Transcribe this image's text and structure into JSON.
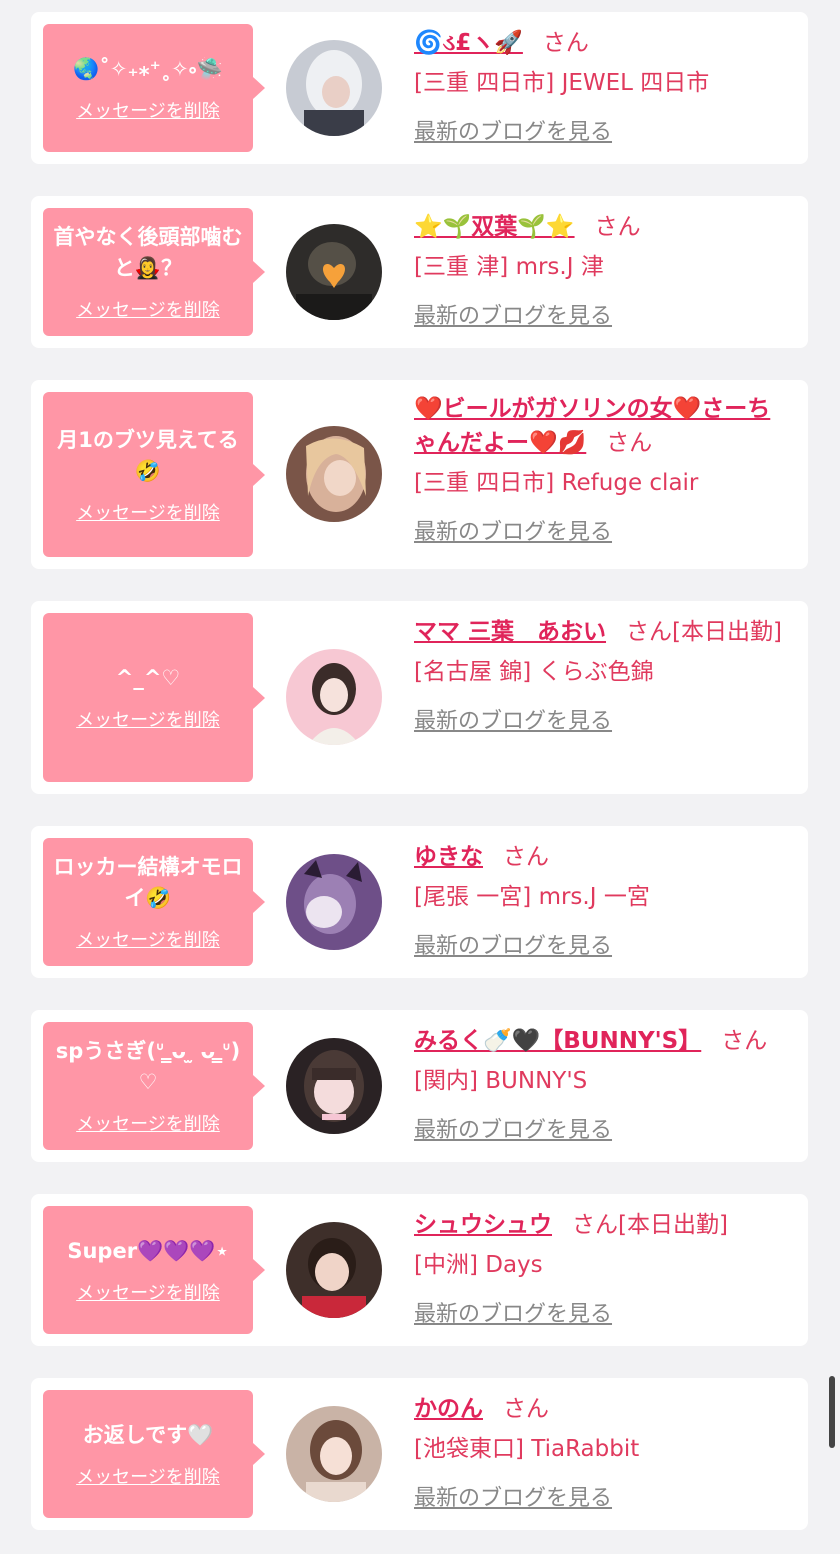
{
  "delete_label": "メッセージを削除",
  "san_label": "さん",
  "blog_label": "最新のブログを見る",
  "colors": {
    "background": "#f2f2f4",
    "bubble": "#ff96a6",
    "name": "#e0245a",
    "location": "#e03a5e",
    "blog_link": "#888888"
  },
  "entries": [
    {
      "message": "🌏˚✧₊⁎⁺˳✧༚🛸",
      "name": "🌀ડ£ヽ🚀",
      "suffix": "",
      "location": "[三重 四日市] JEWEL 四日市"
    },
    {
      "message": "首やなく後頭部噛むと🧛‍♀️？",
      "name": "⭐️🌱双葉🌱⭐️",
      "suffix": "",
      "location": "[三重 津] mrs.J 津"
    },
    {
      "message": "月1のブツ見えてる🤣",
      "name": "❤️ビールがガソリンの女❤️さーちゃんだよー❤️💋",
      "suffix": "",
      "location": "[三重 四日市] Refuge clair"
    },
    {
      "message": "^_^♡",
      "name": "ママ 三葉　あおい",
      "suffix": "[本日出勤]",
      "location": "[名古屋 錦] くらぶ色錦"
    },
    {
      "message": "ロッカー結構オモロイ🤣",
      "name": "ゆきな",
      "suffix": "",
      "location": "[尾張 一宮] mrs.J 一宮"
    },
    {
      "message": "spうさぎ(ᐡ ̳ᴗ ̫ ᴗ ̳ᐡ)♡",
      "name": "みるく🍼🖤【BUNNY'S】",
      "suffix": "",
      "location": "[関内] BUNNY'S"
    },
    {
      "message": "Super💜💜💜⋆",
      "name": "シュウシュウ",
      "suffix": "[本日出勤]",
      "location": "[中洲] Days"
    },
    {
      "message": "お返しです🤍",
      "name": "かのん",
      "suffix": "",
      "location": "[池袋東口] TiaRabbit"
    }
  ]
}
